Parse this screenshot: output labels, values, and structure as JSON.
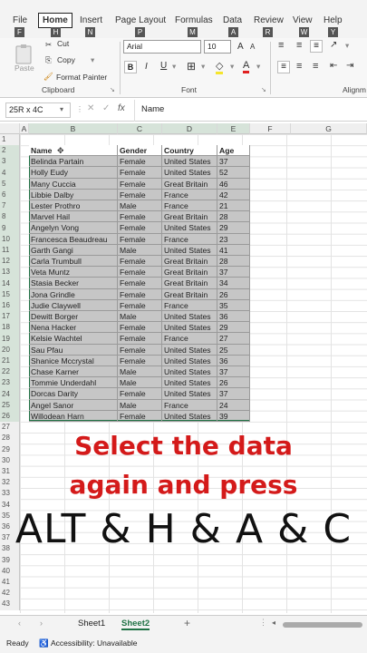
{
  "ribbon_tabs": [
    "File",
    "Home",
    "Insert",
    "Page Layout",
    "Formulas",
    "Data",
    "Review",
    "View",
    "Help"
  ],
  "keytips": [
    "F",
    "H",
    "N",
    "P",
    "M",
    "A",
    "R",
    "W",
    "Y"
  ],
  "clipboard": {
    "cut": "Cut",
    "copy": "Copy",
    "paste": "Paste",
    "format_painter": "Format Painter",
    "label": "Clipboard"
  },
  "font": {
    "name": "Arial",
    "size": "10",
    "label": "Font"
  },
  "alignment_label": "Alignm",
  "name_box": "25R x 4C",
  "formula_value": "Name",
  "columns": [
    "A",
    "B",
    "C",
    "D",
    "E",
    "F",
    "G"
  ],
  "table_header": [
    "Name",
    "Gender",
    "Country",
    "Age"
  ],
  "rows": [
    [
      "Belinda Partain",
      "Female",
      "United States",
      "37"
    ],
    [
      "Holly Eudy",
      "Female",
      "United States",
      "52"
    ],
    [
      "Many Cuccia",
      "Female",
      "Great Britain",
      "46"
    ],
    [
      "Libbie Dalby",
      "Female",
      "France",
      "42"
    ],
    [
      "Lester Prothro",
      "Male",
      "France",
      "21"
    ],
    [
      "Marvel Hail",
      "Female",
      "Great Britain",
      "28"
    ],
    [
      "Angelyn Vong",
      "Female",
      "United States",
      "29"
    ],
    [
      "Francesca Beaudreau",
      "Female",
      "France",
      "23"
    ],
    [
      "Garth Gangi",
      "Male",
      "United States",
      "41"
    ],
    [
      "Carla Trumbull",
      "Female",
      "Great Britain",
      "28"
    ],
    [
      "Veta Muntz",
      "Female",
      "Great Britain",
      "37"
    ],
    [
      "Stasia Becker",
      "Female",
      "Great Britain",
      "34"
    ],
    [
      "Jona Grindle",
      "Female",
      "Great Britain",
      "26"
    ],
    [
      "Judie Claywell",
      "Female",
      "France",
      "35"
    ],
    [
      "Dewitt Borger",
      "Male",
      "United States",
      "36"
    ],
    [
      "Nena Hacker",
      "Female",
      "United States",
      "29"
    ],
    [
      "Kelsie Wachtel",
      "Female",
      "France",
      "27"
    ],
    [
      "Sau Pfau",
      "Female",
      "United States",
      "25"
    ],
    [
      "Shanice Mccrystal",
      "Female",
      "United States",
      "36"
    ],
    [
      "Chase Karner",
      "Male",
      "United States",
      "37"
    ],
    [
      "Tommie Underdahl",
      "Male",
      "United States",
      "26"
    ],
    [
      "Dorcas Darity",
      "Female",
      "United States",
      "37"
    ],
    [
      "Angel Sanor",
      "Male",
      "France",
      "24"
    ],
    [
      "Willodean Harn",
      "Female",
      "United States",
      "39"
    ]
  ],
  "caption": {
    "line1": "Select the data",
    "line2": "again and press",
    "line3": "ALT & H & A & C"
  },
  "sheets": [
    "Sheet1",
    "Sheet2"
  ],
  "status": {
    "ready": "Ready",
    "accessibility": "Accessibility: Unavailable"
  },
  "colors": {
    "excel_green": "#207245",
    "caption_red": "#d41a1a"
  }
}
